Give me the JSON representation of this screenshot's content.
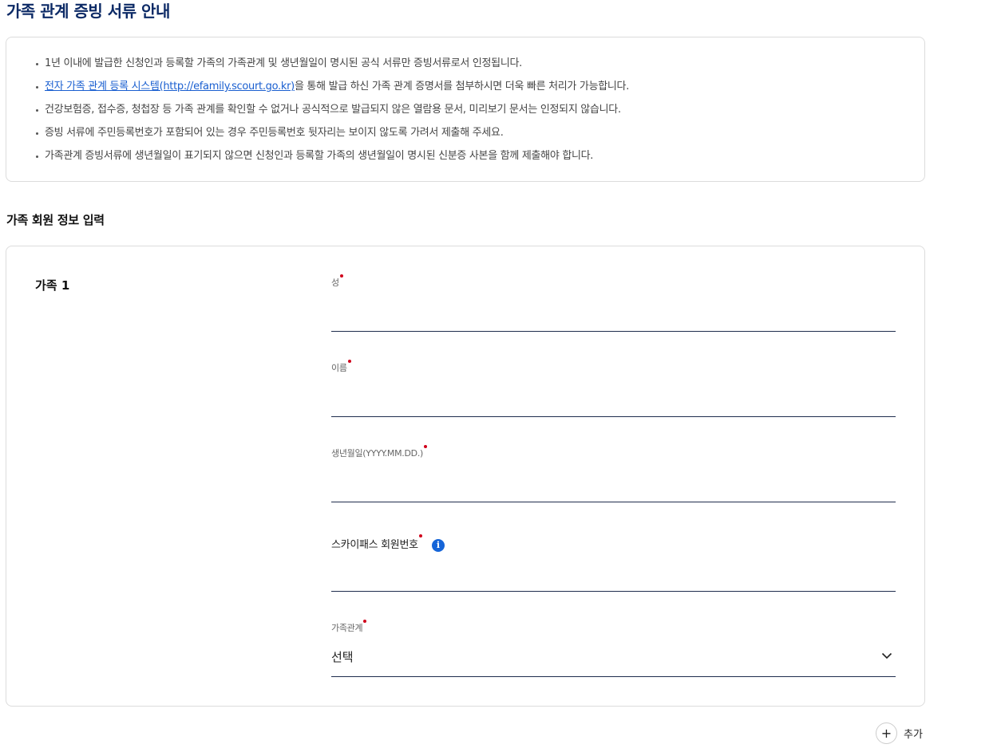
{
  "header": {
    "title": "가족 관계 증빙 서류 안내"
  },
  "notice": {
    "items": [
      {
        "text": "1년 이내에 발급한 신청인과 등록할 가족의 가족관계 및 생년월일이 명시된 공식 서류만 증빙서류로서 인정됩니다."
      },
      {
        "link": "전자 가족 관계 등록 시스템(http://efamily.scourt.go.kr)",
        "text": "을 통해 발급 하신 가족 관계 증명서를 첨부하시면 더욱 빠른 처리가 가능합니다."
      },
      {
        "text": "건강보험증, 접수증, 청첩장 등 가족 관계를 확인할 수 없거나 공식적으로 발급되지 않은 열람용 문서, 미리보기 문서는 인정되지 않습니다."
      },
      {
        "text": "증빙 서류에 주민등록번호가 포함되어 있는 경우 주민등록번호 뒷자리는 보이지 않도록 가려서 제출해 주세요."
      },
      {
        "text": "가족관계 증빙서류에 생년월일이 표기되지 않으면 신청인과 등록할 가족의 생년월일이 명시된 신분증 사본을 함께 제출해야 합니다."
      }
    ]
  },
  "section": {
    "title": "가족 회원 정보 입력"
  },
  "family": {
    "label": "가족 1",
    "fields": {
      "last_name": {
        "label": "성",
        "value": ""
      },
      "first_name": {
        "label": "이름",
        "value": ""
      },
      "birthdate": {
        "label": "생년월일(YYYY.MM.DD.)",
        "value": ""
      },
      "skypass": {
        "label": "스카이패스 회원번호",
        "value": "",
        "info_icon": "info-icon"
      },
      "relation": {
        "label": "가족관계",
        "selected": "선택"
      }
    }
  },
  "actions": {
    "add_label": "추가",
    "add_icon": "plus-icon"
  },
  "colors": {
    "title": "#0c2a66",
    "link": "#1a5fd0",
    "required": "#d0021b",
    "info": "#1565d8"
  }
}
